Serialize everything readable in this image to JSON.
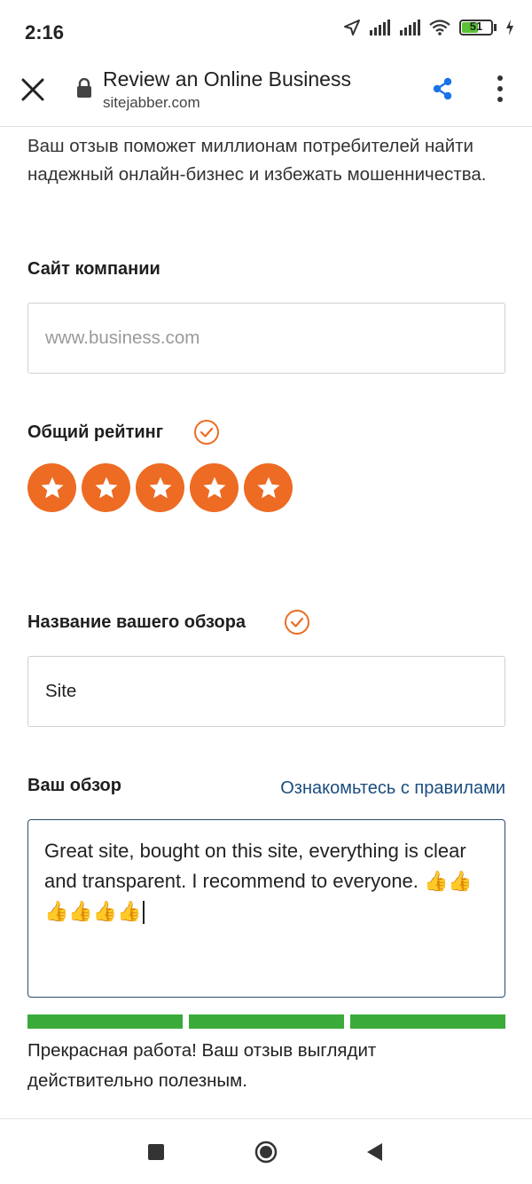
{
  "status_bar": {
    "time": "2:16",
    "battery_level": "51",
    "icons": [
      "location-arrow-icon",
      "signal-icon",
      "signal-icon",
      "wifi-icon",
      "battery-icon",
      "charging-icon"
    ]
  },
  "toolbar": {
    "title": "Review an Online Business",
    "url": "sitejabber.com",
    "accent_color": "#1a73e8"
  },
  "form": {
    "intro": "Ваш отзыв поможет миллионам потребителей найти надежный онлайн-бизнес и избежать мошенничества.",
    "site_label": "Сайт компании",
    "site_placeholder": "www.business.com",
    "rating_label": "Общий рейтинг",
    "rating_value": 5,
    "rating_max": 5,
    "title_label": "Название вашего обзора",
    "title_value": "Site",
    "review_label": "Ваш обзор",
    "guidelines_link": "Ознакомьтесь с правилами",
    "review_text": "Great site, bought on this site, everything is clear and transparent. I recommend to everyone. 👍👍👍👍👍👍",
    "quality_segments_filled": 3,
    "quality_segments_total": 3,
    "feedback": "Прекрасная работа! Ваш отзыв выглядит действительно полезным.",
    "accent_color": "#ed6b23",
    "success_color": "#3aaa3a"
  }
}
